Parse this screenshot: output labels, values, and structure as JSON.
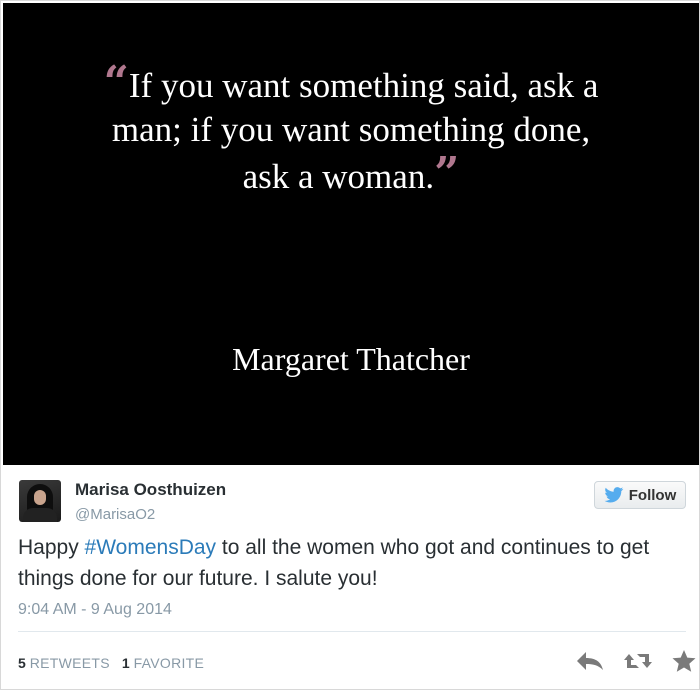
{
  "media": {
    "quote": {
      "line1": "If you want something said, ask a",
      "line2": "man; if you want something done,",
      "line3": "ask a woman."
    },
    "author": "Margaret Thatcher",
    "quote_mark_color": "#b0778e"
  },
  "tweet": {
    "user_name": "Marisa Oosthuizen",
    "user_handle": "@MarisaO2",
    "follow_label": "Follow",
    "text_before": "Happy ",
    "hashtag": "#WomensDay",
    "text_after": " to all the women who got and continues to get things done for our future. I salute you!",
    "timestamp": "9:04 AM - 9 Aug 2014",
    "hashtag_color": "#2b7bb9"
  },
  "stats": {
    "retweets_count": "5",
    "retweets_label": "RETWEETS",
    "favorites_count": "1",
    "favorites_label": "FAVORITE"
  },
  "icons": {
    "follow": "twitter-bird-icon",
    "reply": "reply-arrow-icon",
    "retweet": "retweet-icon",
    "favorite": "star-icon"
  }
}
